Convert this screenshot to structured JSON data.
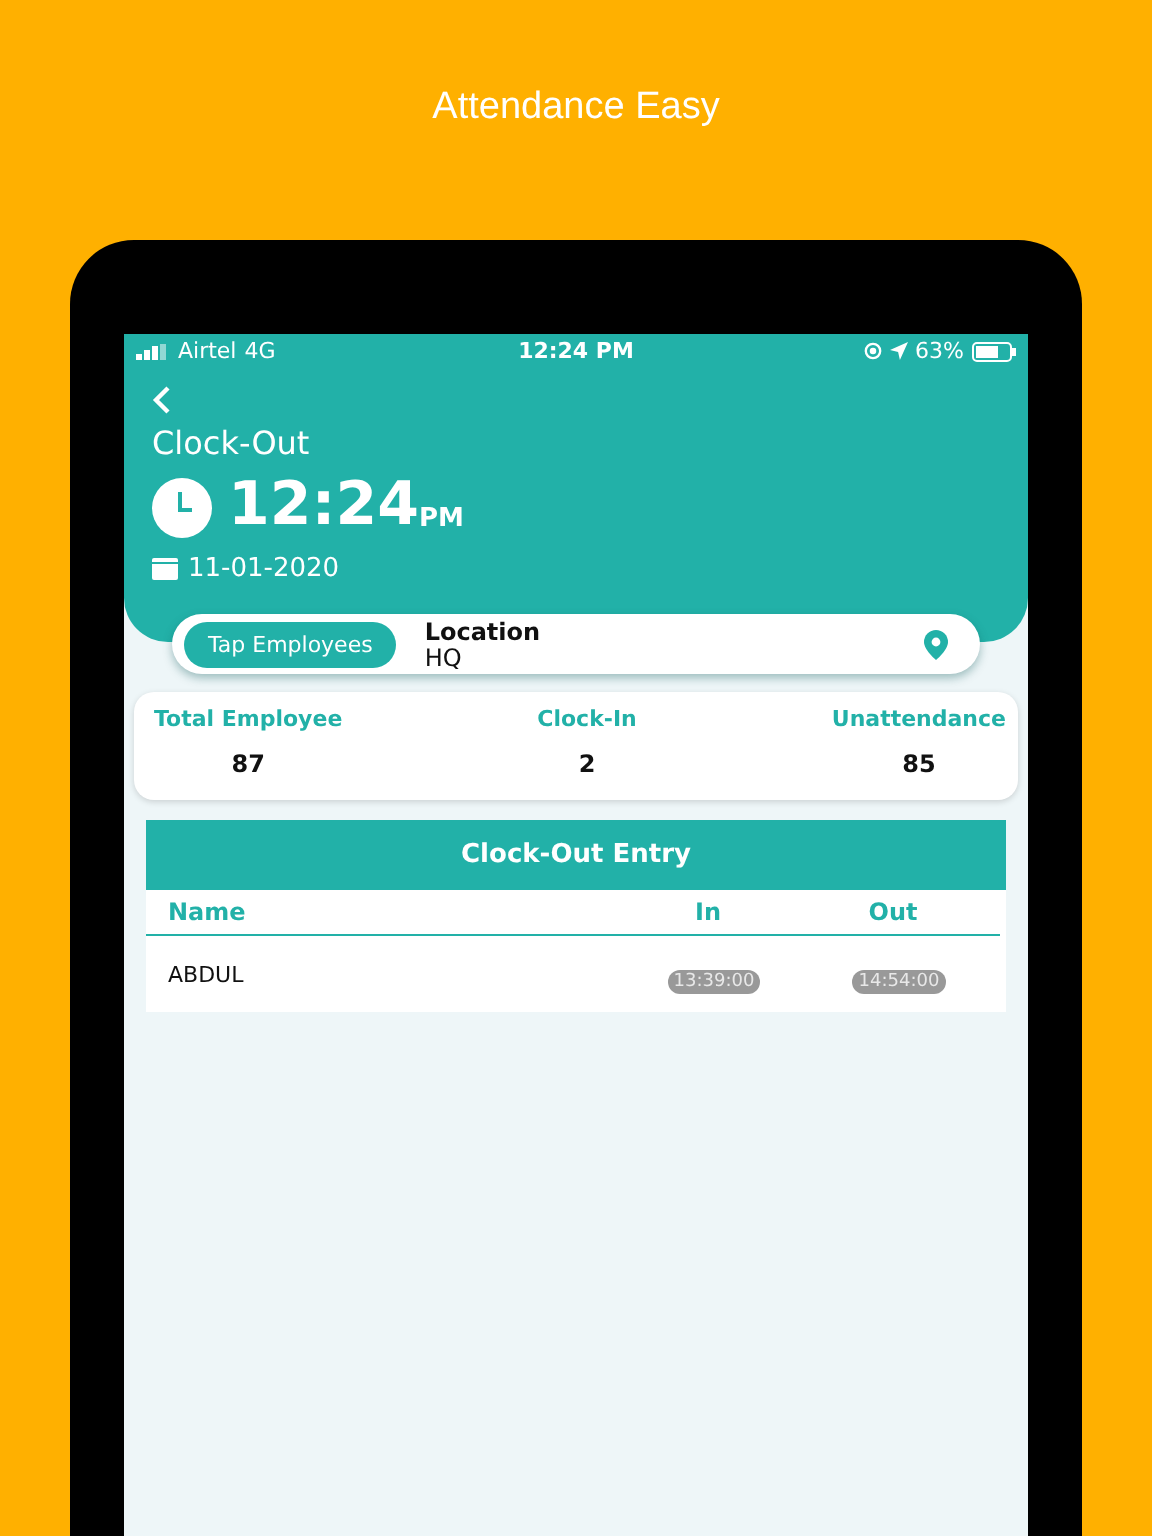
{
  "headline": "Attendance Easy",
  "status_bar": {
    "carrier": "Airtel",
    "network": "4G",
    "time": "12:24 PM",
    "battery": "63%"
  },
  "header": {
    "title": "Clock-Out",
    "time": "12:24",
    "ampm": "PM",
    "date": "11-01-2020"
  },
  "location_bar": {
    "button": "Tap Employees",
    "label": "Location",
    "value": "HQ"
  },
  "stats": [
    {
      "label": "Total Employee",
      "value": "87"
    },
    {
      "label": "Clock-In",
      "value": "2"
    },
    {
      "label": "Unattendance",
      "value": "85"
    }
  ],
  "table": {
    "title": "Clock-Out Entry",
    "columns": [
      "Name",
      "In",
      "Out"
    ],
    "rows": [
      {
        "name": "ABDUL",
        "in": "13:39:00",
        "out": "14:54:00"
      }
    ]
  }
}
